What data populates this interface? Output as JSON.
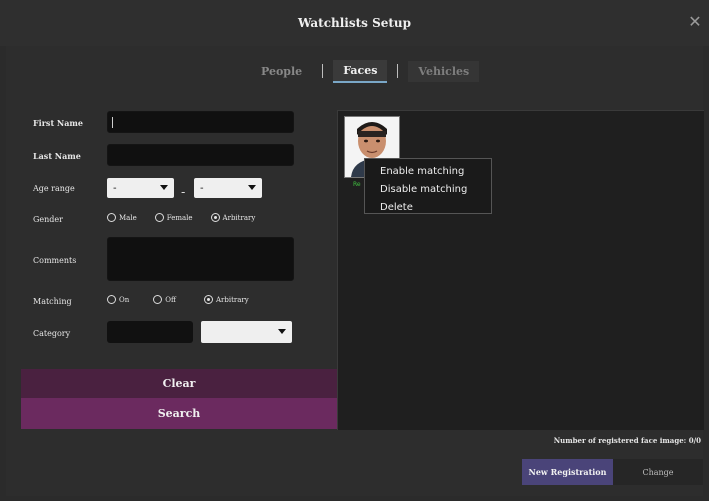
{
  "window": {
    "title": "Watchlists Setup"
  },
  "tabs": [
    {
      "label": "People",
      "active": false
    },
    {
      "label": "Faces",
      "active": true
    },
    {
      "label": "Vehicles",
      "active": false
    }
  ],
  "form": {
    "first_name": {
      "label": "First Name",
      "value": ""
    },
    "last_name": {
      "label": "Last Name",
      "value": ""
    },
    "age_range": {
      "label": "Age range",
      "from": "-",
      "to": "-"
    },
    "gender": {
      "label": "Gender",
      "options": [
        "Male",
        "Female",
        "Arbitrary"
      ],
      "selected": "Arbitrary"
    },
    "comments": {
      "label": "Comments",
      "value": ""
    },
    "matching": {
      "label": "Matching",
      "options": [
        "On",
        "Off",
        "Arbitrary"
      ],
      "selected": "Arbitrary"
    },
    "category": {
      "label": "Category",
      "value": "",
      "select_value": ""
    }
  },
  "buttons": {
    "clear": "Clear",
    "search": "Search",
    "new_registration": "New Registration",
    "change": "Change"
  },
  "results": {
    "context_menu": [
      "Enable matching",
      "Disable matching",
      "Delete"
    ],
    "thumb_caption": "Re"
  },
  "footer": {
    "registered_count": "Number of registered face image: 0/0"
  },
  "colors": {
    "clear_bg": "#4a2140",
    "search_bg": "#6b2a5f",
    "new_registration_bg": "#4a4479"
  }
}
